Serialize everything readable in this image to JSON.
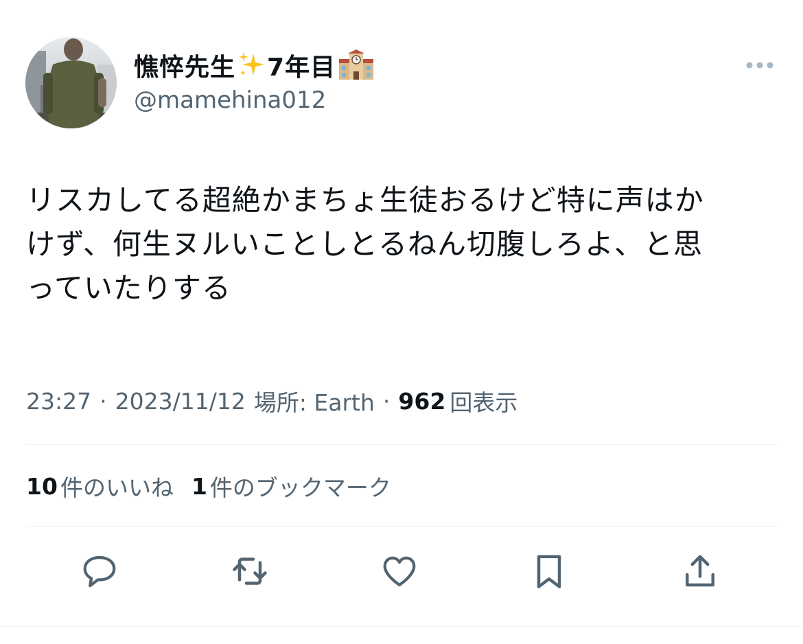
{
  "author": {
    "display_name": "憔悴先生",
    "name_suffix": "7年目",
    "handle": "@mamehina012",
    "icons": [
      "sparkles-emoji",
      "school-building-emoji"
    ]
  },
  "tweet": {
    "text": "リスカしてる超絶かまちょ生徒おるけど特に声はか\nけず、何生ヌルいことしとるねん切腹しろよ、と思\nっていたりする",
    "time": "23:27",
    "separator1": "·",
    "date": "2023/11/12",
    "location": "場所: Earth",
    "separator2": "·",
    "views_count": "962",
    "views_label": "回表示"
  },
  "engagement": {
    "likes_count": "10",
    "likes_label": "件のいいね",
    "bookmarks_count": "1",
    "bookmarks_label": "件のブックマーク"
  },
  "actions": [
    "reply-icon",
    "retweet-icon",
    "like-icon",
    "bookmark-icon",
    "share-icon"
  ],
  "colors": {
    "text_primary": "#0f1419",
    "text_secondary": "#536471",
    "divider": "#eff3f4",
    "icon": "#536471"
  }
}
